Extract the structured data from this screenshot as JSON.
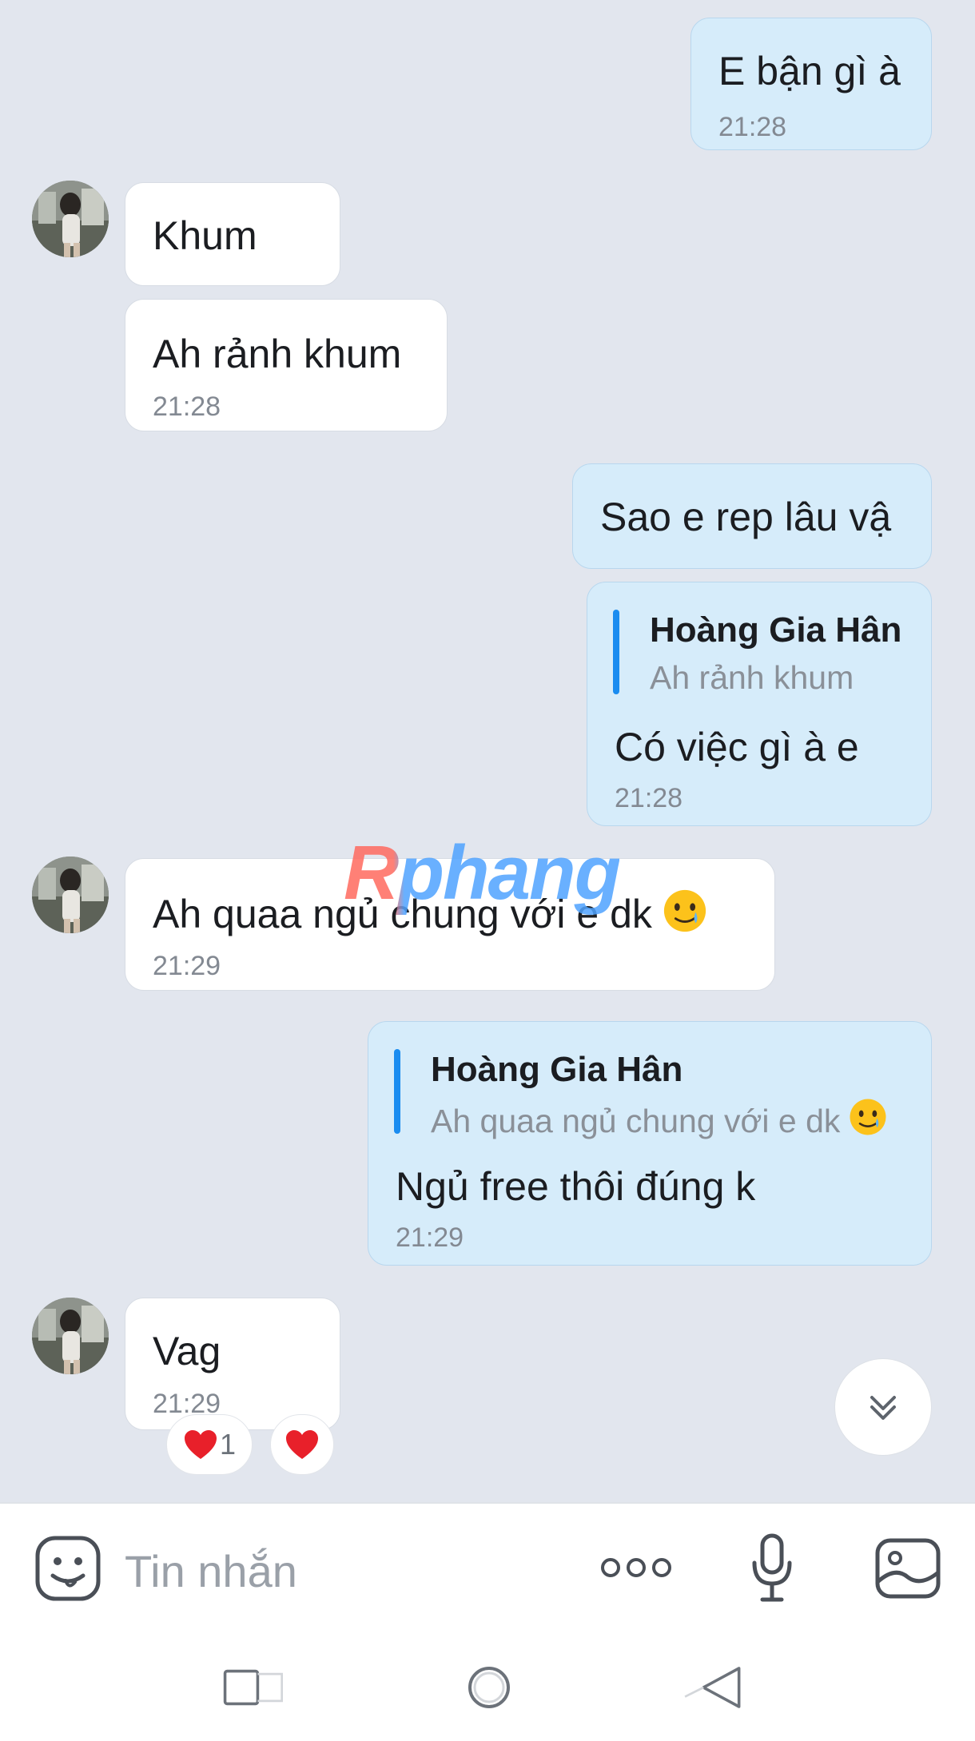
{
  "messages": [
    {
      "side": "out",
      "text": "E bận gì à",
      "time": "21:28"
    },
    {
      "side": "in",
      "text": "Khum"
    },
    {
      "side": "in",
      "text": "Ah rảnh khum",
      "time": "21:28"
    },
    {
      "side": "out",
      "text": "Sao e rep lâu vậ"
    },
    {
      "side": "out",
      "quote": {
        "name": "Hoàng Gia Hân",
        "text": "Ah rảnh khum"
      },
      "text": "Có việc gì à e",
      "time": "21:28"
    },
    {
      "side": "in",
      "text": "Ah quaa ngủ chung với e dk",
      "emoji": "tearful-smile-emoji",
      "time": "21:29"
    },
    {
      "side": "out",
      "quote": {
        "name": "Hoàng Gia Hân",
        "text": "Ah quaa ngủ chung với e dk",
        "emoji": "tearful-smile-emoji"
      },
      "text": "Ngủ free thôi đúng k",
      "time": "21:29"
    },
    {
      "side": "in",
      "text": "Vag",
      "time": "21:29",
      "reactions": [
        {
          "icon": "heart-icon",
          "count": "1"
        },
        {
          "icon": "heart-icon"
        }
      ]
    }
  ],
  "watermark": "Rphang",
  "composer": {
    "placeholder": "Tin nhắn"
  },
  "icons": {
    "sticker": "sticker-smiley-icon",
    "more": "more-dots-icon",
    "mic": "microphone-icon",
    "image": "image-gallery-icon",
    "scroll": "chevron-double-down-icon"
  },
  "colors": {
    "background": "#e2e6ee",
    "incoming_bubble": "#ffffff",
    "outgoing_bubble": "#d6ecfa",
    "quote_bar": "#1a8cf0",
    "time": "#838992",
    "heart": "#e8202a"
  }
}
